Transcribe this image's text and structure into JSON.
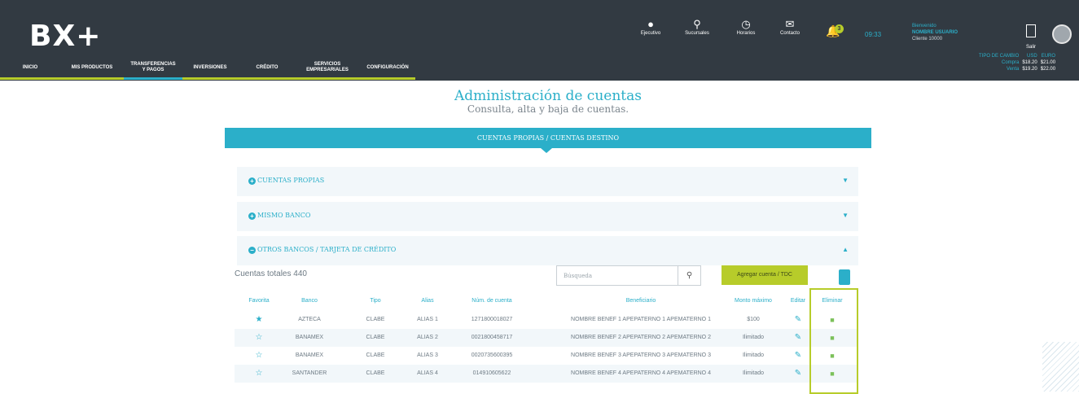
{
  "brand": {
    "logo": "BX+"
  },
  "nav": [
    {
      "label": "INICIO"
    },
    {
      "label": "MIS PRODUCTOS"
    },
    {
      "label": "TRANSFERENCIAS\nY PAGOS"
    },
    {
      "label": "INVERSIONES"
    },
    {
      "label": "CRÉDITO"
    },
    {
      "label": "SERVICIOS\nEMPRESARIALES"
    },
    {
      "label": "CONFIGURACIÓN"
    }
  ],
  "top_icons": [
    {
      "label": "Ejecutivo",
      "icon": "user-icon"
    },
    {
      "label": "Sucursales",
      "icon": "map-pin-icon"
    },
    {
      "label": "Horarios",
      "icon": "alarm-clock-icon"
    },
    {
      "label": "Contacto",
      "icon": "mail-icon"
    }
  ],
  "notifications": {
    "count": "3"
  },
  "clock": "09:33",
  "user": {
    "greeting": "Bienvenido",
    "name": "NOMBRE USUARIO",
    "client": "Cliente 10000"
  },
  "exit_label": "Salir",
  "fx": {
    "title": "TIPO DE CAMBIO",
    "usd": "USD",
    "eur": "EURO",
    "buy_label": "Compra",
    "sell_label": "Venta",
    "usd_buy": "$18.20",
    "usd_sell": "$19.20",
    "eur_buy": "$21.00",
    "eur_sell": "$22.00"
  },
  "page": {
    "title": "Administración de cuentas",
    "subtitle": "Consulta, alta y baja de cuentas."
  },
  "tab": "CUENTAS PROPIAS / CUENTAS DESTINO",
  "sections": [
    {
      "label": "CUENTAS PROPIAS",
      "state": "collapsed"
    },
    {
      "label": "MISMO BANCO",
      "state": "collapsed"
    },
    {
      "label": "OTROS BANCOS / TARJETA DE CRÉDITO",
      "state": "expanded"
    }
  ],
  "toolbar": {
    "totals": "Cuentas totales 440",
    "search_placeholder": "Búsqueda",
    "add_label": "Agregar cuenta / TDC"
  },
  "table": {
    "headers": [
      "Favorita",
      "Banco",
      "Tipo",
      "Alias",
      "Núm. de cuenta",
      "Beneficiario",
      "Monto máximo",
      "Editar",
      "Eliminar"
    ],
    "rows": [
      {
        "favorite": true,
        "bank": "AZTECA",
        "type": "CLABE",
        "alias": "ALIAS 1",
        "account": "127180001802​7",
        "beneficiary": "NOMBRE BENEF 1 APEPATERNO 1 APEMATERNO 1",
        "max": "$100"
      },
      {
        "favorite": false,
        "bank": "BANAMEX",
        "type": "CLABE",
        "alias": "ALIAS 2",
        "account": "002180045871​7",
        "beneficiary": "NOMBRE BENEF 2 APEPATERNO 2 APEMATERNO 2",
        "max": "Ilimitado"
      },
      {
        "favorite": false,
        "bank": "BANAMEX",
        "type": "CLABE",
        "alias": "ALIAS 3",
        "account": "002073560039​5",
        "beneficiary": "NOMBRE BENEF 3 APEPATERNO 3 APEMATERNO 3",
        "max": "Ilimitado"
      },
      {
        "favorite": false,
        "bank": "SANTANDER",
        "type": "CLABE",
        "alias": "ALIAS 4",
        "account": "014910605622",
        "beneficiary": "NOMBRE BENEF 4 APEPATERNO 4 APEMATERNO 4",
        "max": "Ilimitado"
      }
    ]
  },
  "colors": {
    "header_bg": "#323a42",
    "accent": "#2bafc9",
    "lime": "#b7cc2a"
  }
}
